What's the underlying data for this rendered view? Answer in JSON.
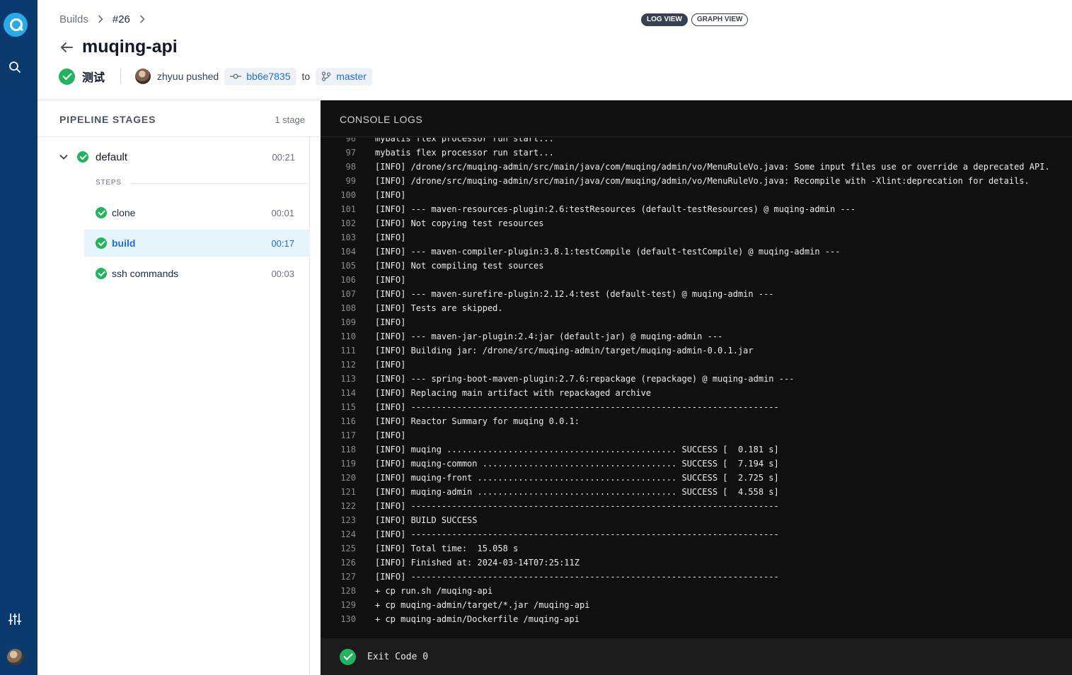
{
  "breadcrumb": {
    "builds": "Builds",
    "build_number": "#26"
  },
  "views": {
    "log": "LOG VIEW",
    "graph": "GRAPH VIEW"
  },
  "repo_title": "muqing-api",
  "build_meta": {
    "status_label": "测试",
    "user": "zhyuu pushed",
    "commit": "bb6e7835",
    "to": "to",
    "branch": "master"
  },
  "stages": {
    "heading": "PIPELINE STAGES",
    "count": "1 stage",
    "stage": {
      "name": "default",
      "time": "00:21"
    },
    "steps_label": "STEPS",
    "steps": [
      {
        "name": "clone",
        "time": "00:01"
      },
      {
        "name": "build",
        "time": "00:17"
      },
      {
        "name": "ssh commands",
        "time": "00:03"
      }
    ]
  },
  "console": {
    "heading": "CONSOLE LOGS",
    "lines": [
      {
        "n": "96",
        "t": "mybatis flex processor run start..."
      },
      {
        "n": "97",
        "t": "mybatis flex processor run start..."
      },
      {
        "n": "98",
        "t": "[INFO] /drone/src/muqing-admin/src/main/java/com/muqing/admin/vo/MenuRuleVo.java: Some input files use or override a deprecated API."
      },
      {
        "n": "99",
        "t": "[INFO] /drone/src/muqing-admin/src/main/java/com/muqing/admin/vo/MenuRuleVo.java: Recompile with -Xlint:deprecation for details."
      },
      {
        "n": "100",
        "t": "[INFO]"
      },
      {
        "n": "101",
        "t": "[INFO] --- maven-resources-plugin:2.6:testResources (default-testResources) @ muqing-admin ---"
      },
      {
        "n": "102",
        "t": "[INFO] Not copying test resources"
      },
      {
        "n": "103",
        "t": "[INFO]"
      },
      {
        "n": "104",
        "t": "[INFO] --- maven-compiler-plugin:3.8.1:testCompile (default-testCompile) @ muqing-admin ---"
      },
      {
        "n": "105",
        "t": "[INFO] Not compiling test sources"
      },
      {
        "n": "106",
        "t": "[INFO]"
      },
      {
        "n": "107",
        "t": "[INFO] --- maven-surefire-plugin:2.12.4:test (default-test) @ muqing-admin ---"
      },
      {
        "n": "108",
        "t": "[INFO] Tests are skipped."
      },
      {
        "n": "109",
        "t": "[INFO]"
      },
      {
        "n": "110",
        "t": "[INFO] --- maven-jar-plugin:2.4:jar (default-jar) @ muqing-admin ---"
      },
      {
        "n": "111",
        "t": "[INFO] Building jar: /drone/src/muqing-admin/target/muqing-admin-0.0.1.jar"
      },
      {
        "n": "112",
        "t": "[INFO]"
      },
      {
        "n": "113",
        "t": "[INFO] --- spring-boot-maven-plugin:2.7.6:repackage (repackage) @ muqing-admin ---"
      },
      {
        "n": "114",
        "t": "[INFO] Replacing main artifact with repackaged archive"
      },
      {
        "n": "115",
        "t": "[INFO] ------------------------------------------------------------------------"
      },
      {
        "n": "116",
        "t": "[INFO] Reactor Summary for muqing 0.0.1:"
      },
      {
        "n": "117",
        "t": "[INFO]"
      },
      {
        "n": "118",
        "t": "[INFO] muqing ............................................. SUCCESS [  0.181 s]"
      },
      {
        "n": "119",
        "t": "[INFO] muqing-common ...................................... SUCCESS [  7.194 s]"
      },
      {
        "n": "120",
        "t": "[INFO] muqing-front ....................................... SUCCESS [  2.725 s]"
      },
      {
        "n": "121",
        "t": "[INFO] muqing-admin ....................................... SUCCESS [  4.558 s]"
      },
      {
        "n": "122",
        "t": "[INFO] ------------------------------------------------------------------------"
      },
      {
        "n": "123",
        "t": "[INFO] BUILD SUCCESS"
      },
      {
        "n": "124",
        "t": "[INFO] ------------------------------------------------------------------------"
      },
      {
        "n": "125",
        "t": "[INFO] Total time:  15.058 s"
      },
      {
        "n": "126",
        "t": "[INFO] Finished at: 2024-03-14T07:25:11Z"
      },
      {
        "n": "127",
        "t": "[INFO] ------------------------------------------------------------------------"
      },
      {
        "n": "128",
        "t": "+ cp run.sh /muqing-api"
      },
      {
        "n": "129",
        "t": "+ cp muqing-admin/target/*.jar /muqing-api"
      },
      {
        "n": "130",
        "t": "+ cp muqing-admin/Dockerfile /muqing-api"
      }
    ],
    "exit_label": "Exit Code 0"
  },
  "colors": {
    "rail": "#0b3a6e",
    "success": "#22b35e",
    "link": "#1d6fd1",
    "console_bg": "#101010"
  },
  "icons": [
    "app-logo-icon",
    "search-icon",
    "settings-sliders-icon",
    "user-avatar-icon",
    "back-arrow-icon",
    "chevron-right-icon",
    "chevron-down-icon",
    "success-check-icon",
    "commit-icon",
    "branch-icon"
  ]
}
